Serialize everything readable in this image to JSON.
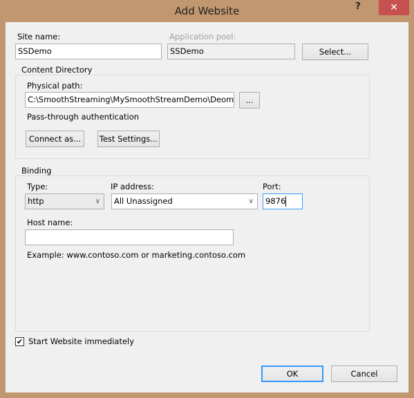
{
  "window": {
    "title": "Add Website",
    "help_label": "?",
    "close_label": "✕",
    "frame_color": "#c0976f",
    "close_color": "#c75050"
  },
  "site": {
    "label": "Site name:",
    "value": "SSDemo"
  },
  "app_pool": {
    "label": "Application pool:",
    "value": "SSDemo",
    "select_label": "Select..."
  },
  "content": {
    "group_label": "Content Directory",
    "path_label": "Physical path:",
    "path_value": "C:\\SmoothStreaming\\MySmoothStreamDemo\\DeomFile",
    "browse_label": "...",
    "auth_text": "Pass-through authentication",
    "connect_label": "Connect as...",
    "test_label": "Test Settings..."
  },
  "binding": {
    "group_label": "Binding",
    "type_label": "Type:",
    "type_value": "http",
    "ip_label": "IP address:",
    "ip_value": "All Unassigned",
    "port_label": "Port:",
    "port_value": "9876",
    "host_label": "Host name:",
    "host_value": "",
    "example": "Example: www.contoso.com or marketing.contoso.com"
  },
  "start": {
    "label": "Start Website immediately",
    "checked": true,
    "check_glyph": "✔"
  },
  "footer": {
    "ok_label": "OK",
    "cancel_label": "Cancel"
  }
}
